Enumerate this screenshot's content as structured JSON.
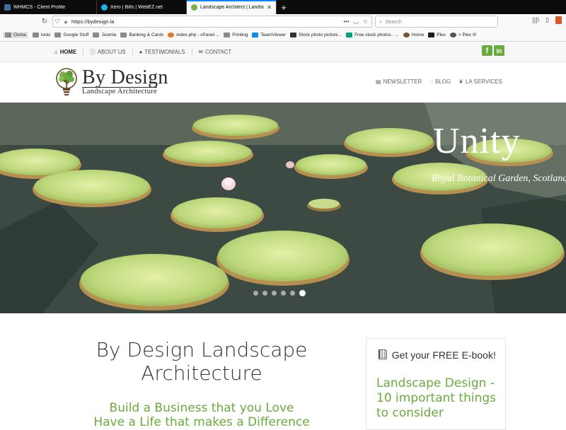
{
  "browser": {
    "tabs": [
      {
        "title": "WHMCS - Client Profile",
        "favicon_color": "#3a6ea5"
      },
      {
        "title": "Xero | Bills | WebEZ.net",
        "favicon_color": "#13b5ea"
      },
      {
        "title": "Landscape Architect | Landsca",
        "favicon_color": "#7fae4a",
        "active": true
      }
    ],
    "new_tab_label": "+",
    "url": "https://bydesign.la",
    "search_placeholder": "Search",
    "bookmarks": [
      {
        "label": "Ooma",
        "type": "folder"
      },
      {
        "label": "tools",
        "type": "folder"
      },
      {
        "label": "Google Stuff",
        "type": "folder"
      },
      {
        "label": "Joomla",
        "type": "folder"
      },
      {
        "label": "Banking & Cards",
        "type": "folder"
      },
      {
        "label": "index.php - cPanel ...",
        "type": "link",
        "color": "#e8742a"
      },
      {
        "label": "Printing",
        "type": "folder"
      },
      {
        "label": "TeamViewer",
        "type": "link",
        "color": "#0e8ee9"
      },
      {
        "label": "Stock photo picture...",
        "type": "link",
        "color": "#333333"
      },
      {
        "label": "Free stock photos · ...",
        "type": "link",
        "color": "#05a081"
      },
      {
        "label": "Home",
        "type": "link",
        "color": "#7a5230"
      },
      {
        "label": "Plex",
        "type": "link",
        "color": "#e5a00d"
      },
      {
        "label": "> Plex It!",
        "type": "link",
        "color": "#555555"
      }
    ]
  },
  "site": {
    "topnav": [
      {
        "label": "HOME",
        "icon": "home-icon",
        "active": true
      },
      {
        "label": "ABOUT US",
        "icon": "info-icon"
      },
      {
        "label": "TESTIMONIALS",
        "icon": "comment-icon"
      },
      {
        "label": "CONTACT",
        "icon": "envelope-icon"
      }
    ],
    "social": {
      "facebook": "f",
      "linkedin": "in",
      "color": "#6aab3e"
    },
    "logo": {
      "title": "By Design",
      "subtitle": "Landscape Architecture"
    },
    "mainnav": [
      {
        "label": "NEWSLETTER",
        "icon": "newspaper-icon"
      },
      {
        "label": "BLOG",
        "icon": "comment-icon"
      },
      {
        "label": "LA SERVICES",
        "icon": "leaf-icon"
      }
    ],
    "slider": {
      "title": "Unity",
      "caption": "Royal Botanical Garden, Scotland",
      "dots": 6,
      "active_dot": 6
    },
    "heading": "By Design Landscape Architecture",
    "tagline_1": "Build a Business that you Love",
    "tagline_2": "Have a Life that makes a Difference",
    "ebook": {
      "heading": "Get your FREE E-book!",
      "title": "Landscape Design - 10 important things to consider"
    },
    "accent": "#6aab3e"
  }
}
